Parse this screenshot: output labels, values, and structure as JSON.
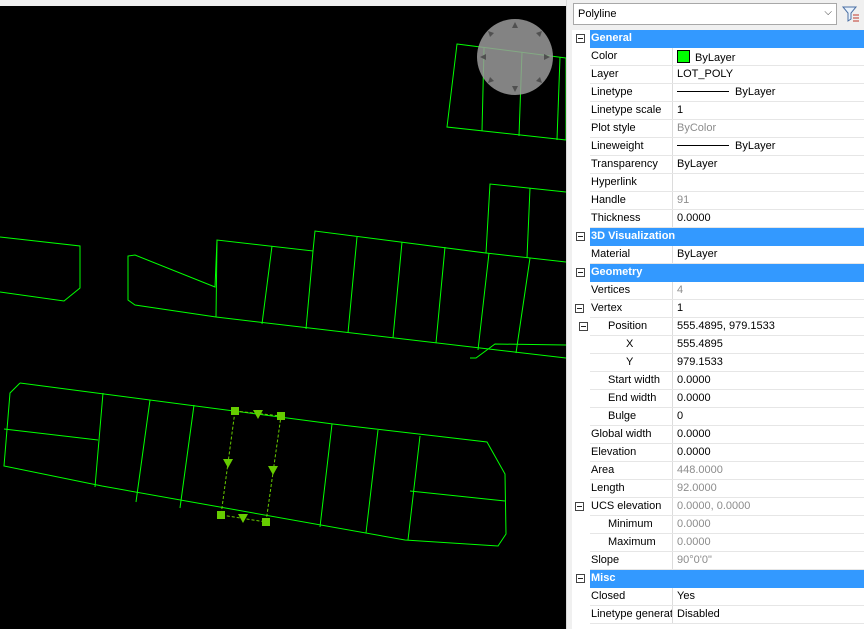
{
  "properties_panel": {
    "object_type": "Polyline",
    "categories": [
      {
        "name": "General",
        "rows": [
          {
            "name": "Color",
            "value": "ByLayer",
            "swatch": "#00ff00"
          },
          {
            "name": "Layer",
            "value": "LOT_POLY"
          },
          {
            "name": "Linetype",
            "value": "ByLayer",
            "line": true
          },
          {
            "name": "Linetype scale",
            "value": "1"
          },
          {
            "name": "Plot style",
            "value": "ByColor",
            "gray": true
          },
          {
            "name": "Lineweight",
            "value": "ByLayer",
            "line": true
          },
          {
            "name": "Transparency",
            "value": "ByLayer"
          },
          {
            "name": "Hyperlink",
            "value": ""
          },
          {
            "name": "Handle",
            "value": "91",
            "gray": true
          },
          {
            "name": "Thickness",
            "value": "0.0000"
          }
        ]
      },
      {
        "name": "3D Visualization",
        "rows": [
          {
            "name": "Material",
            "value": "ByLayer"
          }
        ]
      },
      {
        "name": "Geometry",
        "rows": [
          {
            "name": "Vertices",
            "value": "4",
            "gray": true
          },
          {
            "name": "Vertex",
            "value": "1",
            "expand": true
          },
          {
            "name": "Position",
            "value": "555.4895, 979.1533",
            "expand": true,
            "level": 1
          },
          {
            "name": "X",
            "value": "555.4895",
            "level": 3
          },
          {
            "name": "Y",
            "value": "979.1533",
            "level": 3
          },
          {
            "name": "Start width",
            "value": "0.0000",
            "level": 1
          },
          {
            "name": "End width",
            "value": "0.0000",
            "level": 1
          },
          {
            "name": "Bulge",
            "value": "0",
            "level": 1
          },
          {
            "name": "Global width",
            "value": "0.0000"
          },
          {
            "name": "Elevation",
            "value": "0.0000"
          },
          {
            "name": "Area",
            "value": "448.0000",
            "gray": true
          },
          {
            "name": "Length",
            "value": "92.0000",
            "gray": true
          },
          {
            "name": "UCS elevation",
            "value": "0.0000, 0.0000",
            "gray": true,
            "expand": true
          },
          {
            "name": "Minimum",
            "value": "0.0000",
            "gray": true,
            "level": 1
          },
          {
            "name": "Maximum",
            "value": "0.0000",
            "gray": true,
            "level": 1
          },
          {
            "name": "Slope",
            "value": "90°0'0\"",
            "gray": true
          }
        ]
      },
      {
        "name": "Misc",
        "rows": [
          {
            "name": "Closed",
            "value": "Yes"
          },
          {
            "name": "Linetype generation",
            "value": "Disabled"
          }
        ]
      }
    ]
  },
  "colors": {
    "lot_lines": "#00ff00",
    "selection_grips": "#66cc00",
    "category_header": "#3399ff",
    "canvas_background": "#000000"
  },
  "icons": {
    "filter": "quick-select-filter-icon",
    "navigation": "navigation-wheel-icon"
  }
}
